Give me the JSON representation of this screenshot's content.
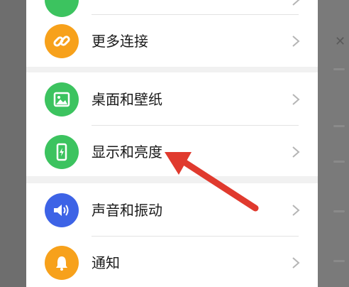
{
  "settings": {
    "items": [
      {
        "label": "",
        "icon": "partial-green-icon",
        "color": "#3cc35f"
      },
      {
        "label": "更多连接",
        "icon": "link-icon",
        "color": "#f7a11b"
      },
      {
        "label": "桌面和壁纸",
        "icon": "image-icon",
        "color": "#3cc35f"
      },
      {
        "label": "显示和亮度",
        "icon": "phone-brightness-icon",
        "color": "#3cc35f"
      },
      {
        "label": "声音和振动",
        "icon": "speaker-icon",
        "color": "#3d63e6"
      },
      {
        "label": "通知",
        "icon": "bell-icon",
        "color": "#f7a11b"
      }
    ]
  },
  "annotation": {
    "arrow_color": "#e03a2e",
    "target": "显示和亮度"
  }
}
